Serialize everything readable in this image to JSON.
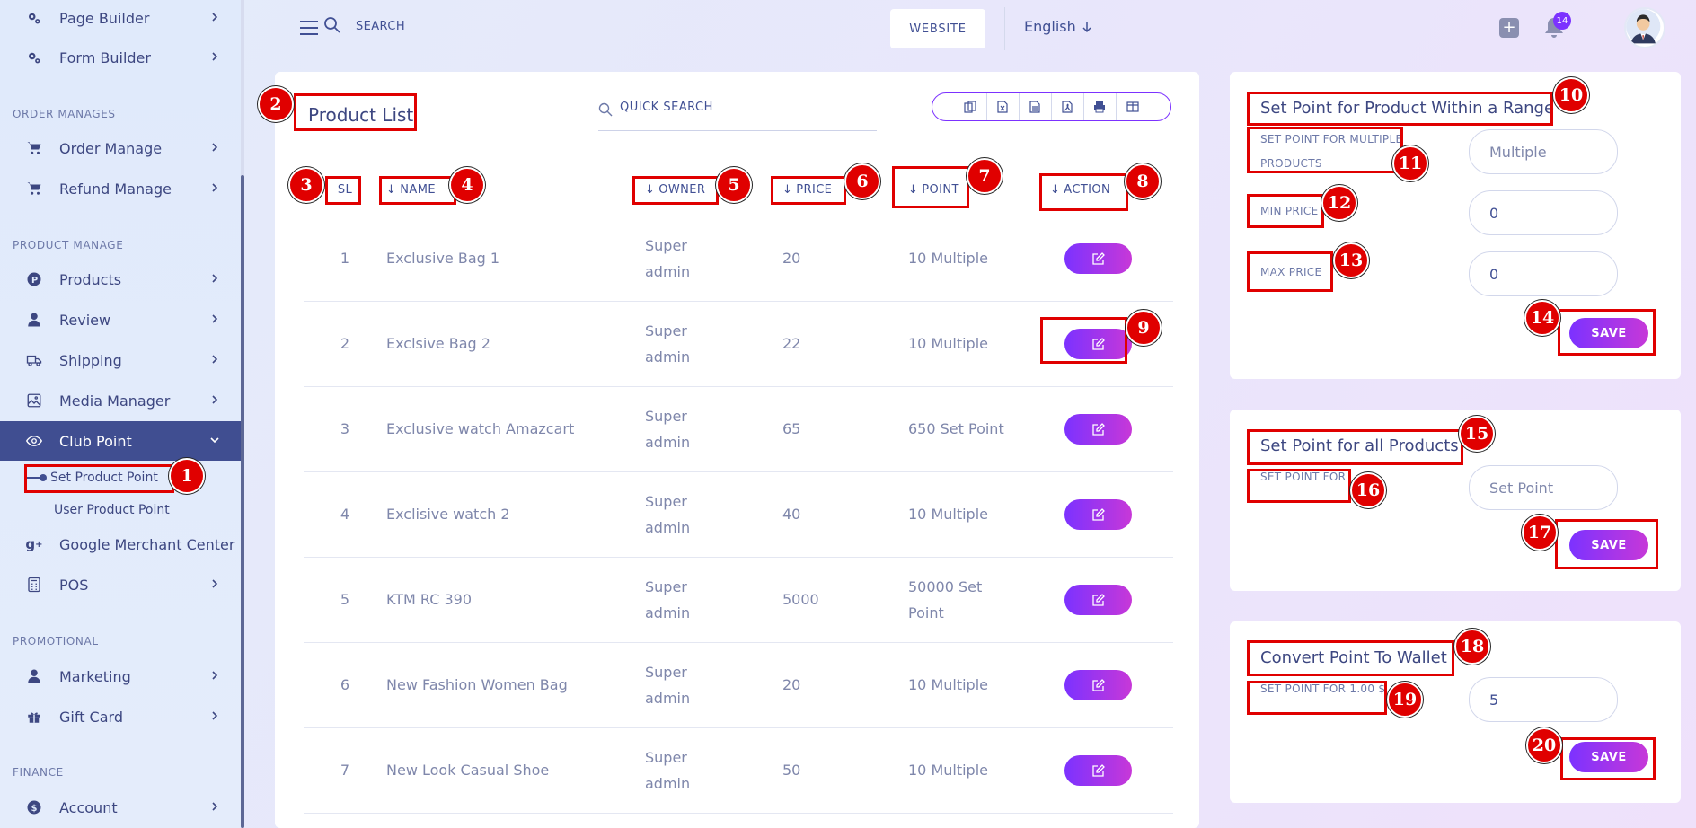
{
  "sidebar": {
    "items": [
      {
        "label": "Page Builder",
        "icon": "gears-icon"
      },
      {
        "label": "Form Builder",
        "icon": "gears-icon"
      }
    ],
    "sections": {
      "order": "ORDER MANAGES",
      "product": "PRODUCT MANAGE",
      "promotional": "PROMOTIONAL",
      "finance": "FINANCE"
    },
    "order_items": [
      {
        "label": "Order Manage",
        "icon": "cart-icon"
      },
      {
        "label": "Refund Manage",
        "icon": "cart-icon"
      }
    ],
    "product_items": [
      {
        "label": "Products",
        "icon": "product-icon"
      },
      {
        "label": "Review",
        "icon": "user-icon"
      },
      {
        "label": "Shipping",
        "icon": "truck-icon"
      },
      {
        "label": "Media Manager",
        "icon": "image-icon"
      },
      {
        "label": "Club Point",
        "icon": "eye-icon"
      }
    ],
    "club_sub": [
      "Set Product Point",
      "User Product Point"
    ],
    "more_items": [
      {
        "label": "Google Merchant Center",
        "icon": "google-plus-icon"
      },
      {
        "label": "POS",
        "icon": "calculator-icon"
      }
    ],
    "promo_items": [
      {
        "label": "Marketing",
        "icon": "user-icon"
      },
      {
        "label": "Gift Card",
        "icon": "gift-icon"
      }
    ],
    "finance_items": [
      {
        "label": "Account",
        "icon": "dollar-icon"
      }
    ]
  },
  "header": {
    "search_placeholder": "SEARCH",
    "website_label": "WEBSITE",
    "language": "English",
    "notification_count": "14"
  },
  "product_list": {
    "title": "Product List",
    "quick_search_placeholder": "QUICK SEARCH",
    "export_icons": [
      "copy-icon",
      "excel-icon",
      "csv-icon",
      "pdf-icon",
      "print-icon",
      "columns-icon"
    ],
    "columns": [
      "SL",
      "NAME",
      "OWNER",
      "PRICE",
      "POINT",
      "ACTION"
    ],
    "rows": [
      {
        "sl": "1",
        "name": "Exclusive Bag 1",
        "owner": "Super admin",
        "price": "20",
        "point": "10 Multiple"
      },
      {
        "sl": "2",
        "name": "Exclsive Bag 2",
        "owner": "Super admin",
        "price": "22",
        "point": "10 Multiple"
      },
      {
        "sl": "3",
        "name": "Exclusive watch Amazcart",
        "owner": "Super admin",
        "price": "65",
        "point": "650 Set Point"
      },
      {
        "sl": "4",
        "name": "Exclisive watch 2",
        "owner": "Super admin",
        "price": "40",
        "point": "10 Multiple"
      },
      {
        "sl": "5",
        "name": "KTM RC 390",
        "owner": "Super admin",
        "price": "5000",
        "point": "50000 Set Point"
      },
      {
        "sl": "6",
        "name": "New Fashion Women Bag",
        "owner": "Super admin",
        "price": "20",
        "point": "10 Multiple"
      },
      {
        "sl": "7",
        "name": "New Look Casual Shoe",
        "owner": "Super admin",
        "price": "50",
        "point": "10 Multiple"
      }
    ]
  },
  "range_card": {
    "title": "Set Point for Product Within a Range",
    "multiple_label": "SET POINT FOR MULTIPLE PRODUCTS",
    "multiple_placeholder": "Multiple",
    "min_label": "MIN PRICE",
    "min_value": "0",
    "max_label": "MAX PRICE",
    "max_value": "0",
    "save_label": "SAVE"
  },
  "all_card": {
    "title": "Set Point for all Products",
    "label": "SET POINT FOR",
    "placeholder": "Set Point",
    "save_label": "SAVE"
  },
  "wallet_card": {
    "title": "Convert Point To Wallet",
    "label": "SET POINT FOR 1.00 $",
    "value": "5",
    "save_label": "SAVE"
  },
  "annotations": [
    "1",
    "2",
    "3",
    "4",
    "5",
    "6",
    "7",
    "8",
    "9",
    "10",
    "11",
    "12",
    "13",
    "14",
    "15",
    "16",
    "17",
    "18",
    "19",
    "20"
  ],
  "colors": {
    "accent": "#7c32ff",
    "accent2": "#c738d8",
    "sidebar_active": "#404e91",
    "text": "#415094",
    "annotation": "#e00000"
  }
}
